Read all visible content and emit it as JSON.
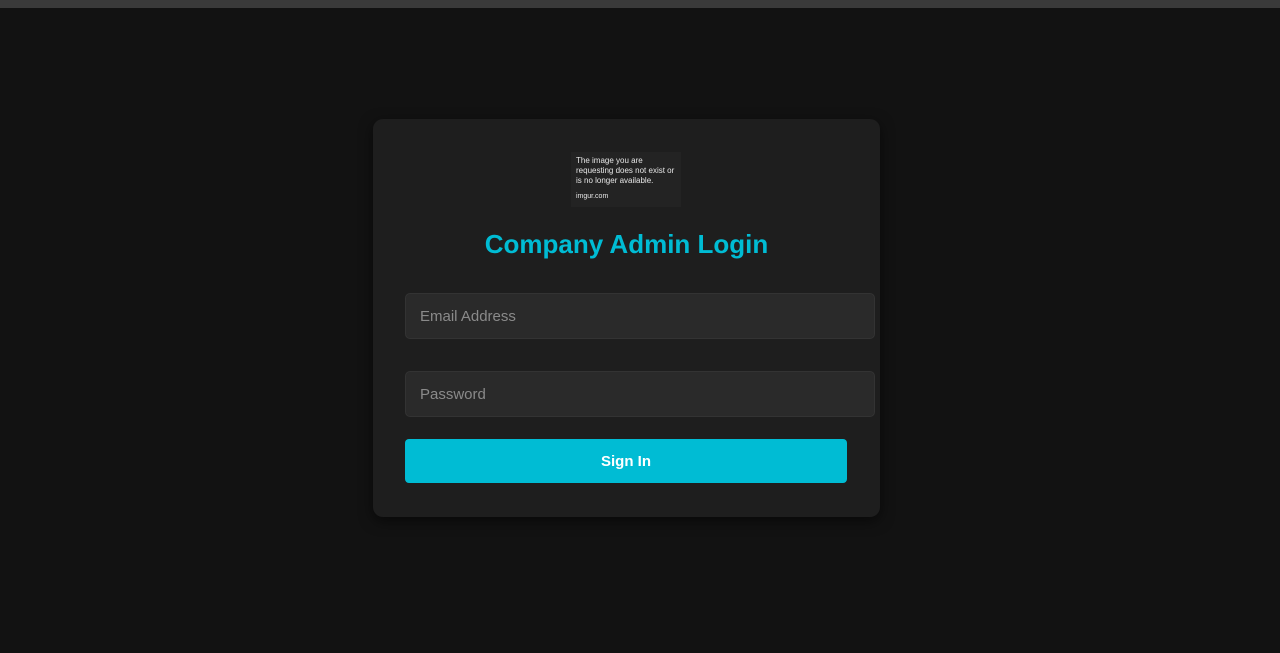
{
  "logo": {
    "message": "The image you are requesting does not exist or is no longer available.",
    "domain": "imgur.com"
  },
  "login": {
    "title": "Company Admin Login",
    "email_placeholder": "Email Address",
    "password_placeholder": "Password",
    "submit_label": "Sign In"
  },
  "colors": {
    "background": "#121212",
    "card": "#1e1e1e",
    "input": "#2a2a2a",
    "accent": "#00bcd4",
    "button_text": "#ffffff"
  }
}
